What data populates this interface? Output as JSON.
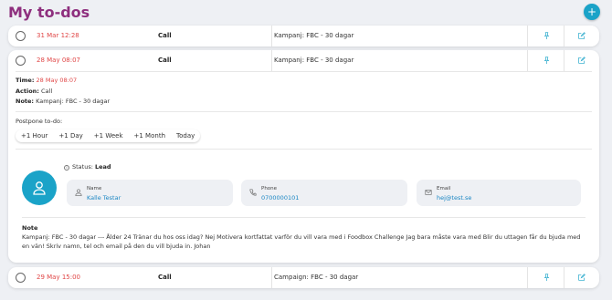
{
  "page": {
    "title": "My to-dos",
    "add_icon": "plus-icon"
  },
  "todos": [
    {
      "date": "31 Mar 12:28",
      "type": "Call",
      "campaign": "Kampanj: FBC - 30 dagar"
    },
    {
      "date": "28 May 08:07",
      "type": "Call",
      "campaign": "Kampanj: FBC - 30 dagar"
    },
    {
      "date": "29 May 15:00",
      "type": "Call",
      "campaign": "Campaign: FBC - 30 dagar"
    }
  ],
  "details": {
    "time_label": "Time:",
    "time_value": "28 May 08:07",
    "action_label": "Action:",
    "action_value": "Call",
    "note_label": "Note:",
    "note_value": "Kampanj: FBC - 30 dagar",
    "postpone_label": "Postpone to-do:",
    "postpone_options": [
      "+1 Hour",
      "+1 Day",
      "+1 Week",
      "+1 Month",
      "Today"
    ]
  },
  "contact": {
    "status_label": "Status:",
    "status_value": "Lead",
    "name_label": "Name",
    "name_value": "Kalle Testar",
    "phone_label": "Phone",
    "phone_value": "0700000101",
    "email_label": "Email",
    "email_value": "hej@test.se"
  },
  "note": {
    "title": "Note",
    "text": "Kampanj: FBC - 30 dagar --- Ålder 24 Tränar du hos oss idag? Nej Motivera kortfattat varför du vill vara med i Foodbox Challenge Jag bara måste vara med Blir du uttagen får du bjuda med en vän! Skriv namn, tel och email på den du vill bjuda in. Johan"
  },
  "colors": {
    "accent": "#1aa3c8",
    "title": "#8e2f7e",
    "date": "#e04646"
  }
}
